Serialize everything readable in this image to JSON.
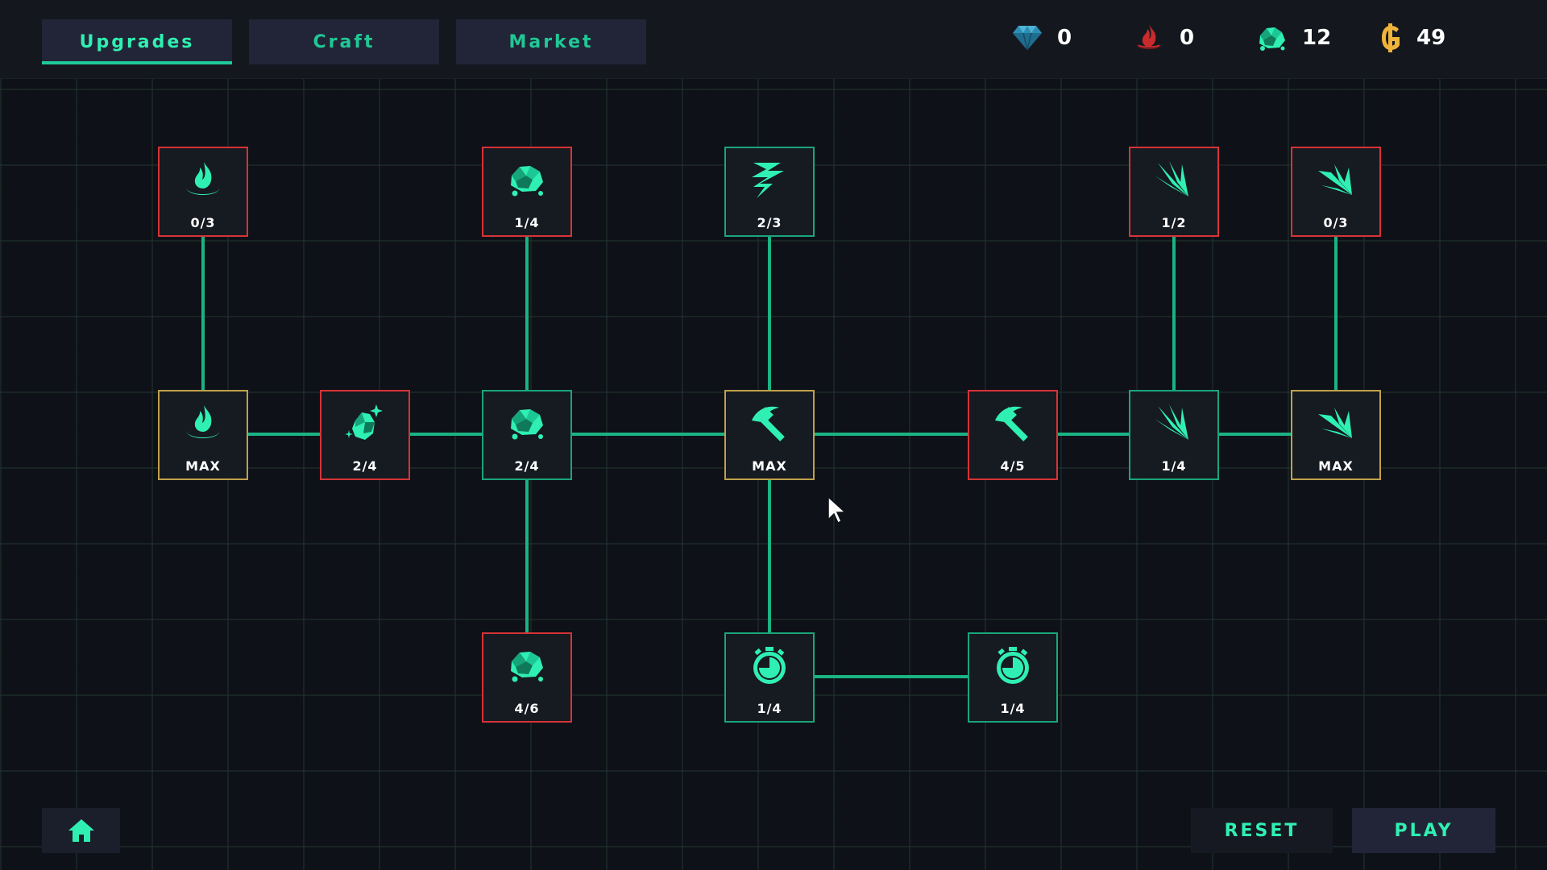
{
  "tabs": [
    {
      "label": "Upgrades",
      "active": true
    },
    {
      "label": "Craft",
      "active": false
    },
    {
      "label": "Market",
      "active": false
    }
  ],
  "resources": [
    {
      "icon": "diamond-icon",
      "value": "0",
      "color": "#2b8fb5"
    },
    {
      "icon": "fire-icon",
      "value": "0",
      "color": "#c72b2b"
    },
    {
      "icon": "ore-icon",
      "value": "12",
      "color": "#2ff0b2"
    },
    {
      "icon": "gold-coin-icon",
      "value": "49",
      "color": "#f0b43a"
    }
  ],
  "upgrades": [
    {
      "id": "fire-t1",
      "icon": "fire-icon",
      "level": "0/3",
      "state": "locked"
    },
    {
      "id": "fire-t0",
      "icon": "fire-icon",
      "level": "MAX",
      "state": "maxed"
    },
    {
      "id": "ore-sparkle",
      "icon": "ore-sparkle-icon",
      "level": "2/4",
      "state": "locked"
    },
    {
      "id": "ore-top",
      "icon": "ore-icon",
      "level": "1/4",
      "state": "locked"
    },
    {
      "id": "ore-mid",
      "icon": "ore-icon",
      "level": "2/4",
      "state": "available"
    },
    {
      "id": "ore-bottom",
      "icon": "ore-icon",
      "level": "4/6",
      "state": "locked"
    },
    {
      "id": "lightning-top",
      "icon": "lightning-icon",
      "level": "2/3",
      "state": "available"
    },
    {
      "id": "pickaxe-center",
      "icon": "pickaxe-icon",
      "level": "MAX",
      "state": "maxed"
    },
    {
      "id": "timer-left",
      "icon": "timer-icon",
      "level": "1/4",
      "state": "available"
    },
    {
      "id": "timer-right",
      "icon": "timer-icon",
      "level": "1/4",
      "state": "available"
    },
    {
      "id": "pickaxe-right",
      "icon": "pickaxe-icon",
      "level": "4/5",
      "state": "locked"
    },
    {
      "id": "claw-top",
      "icon": "claw-icon",
      "level": "1/2",
      "state": "locked"
    },
    {
      "id": "claw-mid",
      "icon": "claw-icon",
      "level": "1/4",
      "state": "available"
    },
    {
      "id": "arrow-top",
      "icon": "arrow-burst-icon",
      "level": "0/3",
      "state": "locked"
    },
    {
      "id": "arrow-mid",
      "icon": "arrow-burst-icon",
      "level": "MAX",
      "state": "maxed"
    }
  ],
  "colors": {
    "accent": "#1fc99a",
    "locked": "#d63337",
    "maxed": "#bfa14a",
    "available": "#1aa57a"
  },
  "footer": {
    "home_icon": "home-icon",
    "reset_label": "RESET",
    "play_label": "PLAY"
  }
}
